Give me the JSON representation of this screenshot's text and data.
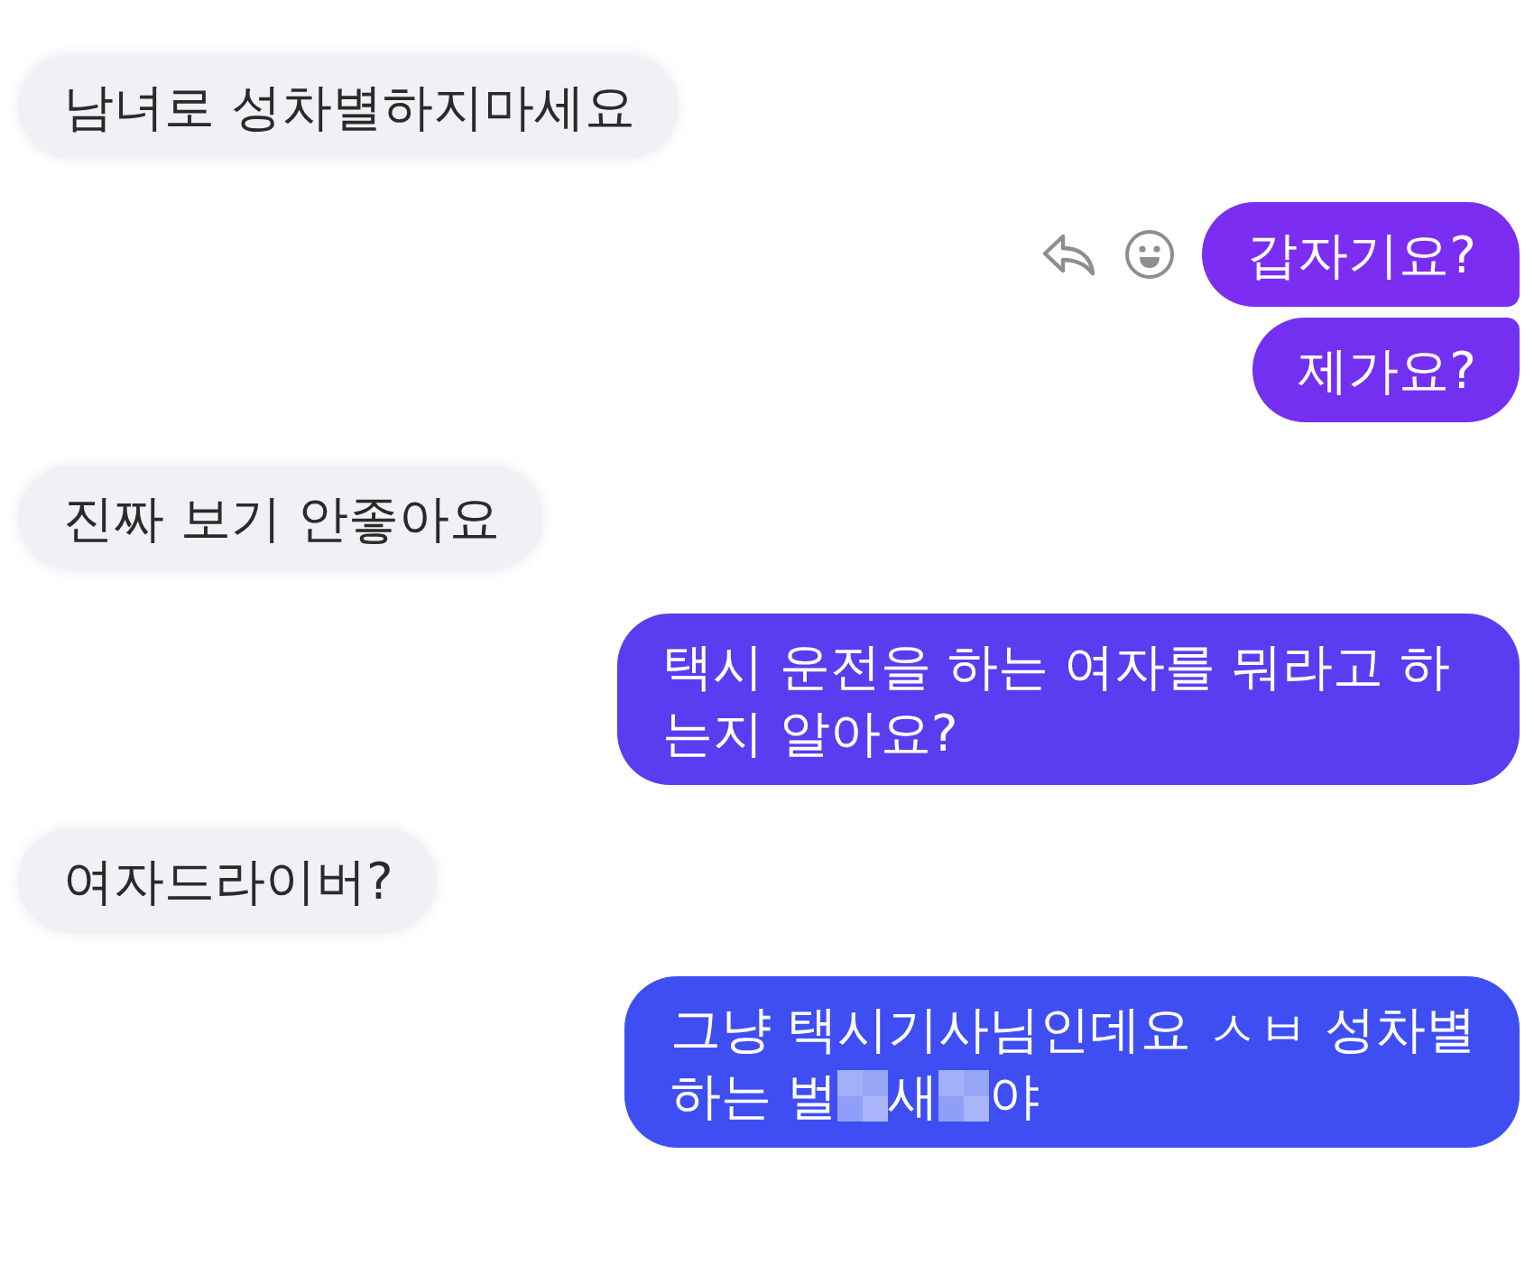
{
  "messages": [
    {
      "kind": "received",
      "text": "남녀로 성차별하지마세요"
    },
    {
      "kind": "sent",
      "text": "갑자기요?",
      "color": "#7b2df2",
      "actions_visible": true
    },
    {
      "kind": "sent",
      "text": "제가요?",
      "color": "#7430f1"
    },
    {
      "kind": "received",
      "text": "진짜 보기 안좋아요"
    },
    {
      "kind": "sent",
      "text": "택시 운전을 하는 여자를 뭐라고 하는지 알아요?",
      "color": "#583df1"
    },
    {
      "kind": "received",
      "text": "여자드라이버?"
    },
    {
      "kind": "sent",
      "color": "#3e4ef3",
      "lines": [
        [
          {
            "kind": "text",
            "text": "그냥 택시기사님인데요 ㅅㅂ 성차별"
          }
        ],
        [
          {
            "kind": "text",
            "text": "하는 벌"
          },
          {
            "kind": "censored"
          },
          {
            "kind": "text",
            "text": "새"
          },
          {
            "kind": "censored"
          },
          {
            "kind": "text",
            "text": "야"
          }
        ]
      ]
    }
  ]
}
